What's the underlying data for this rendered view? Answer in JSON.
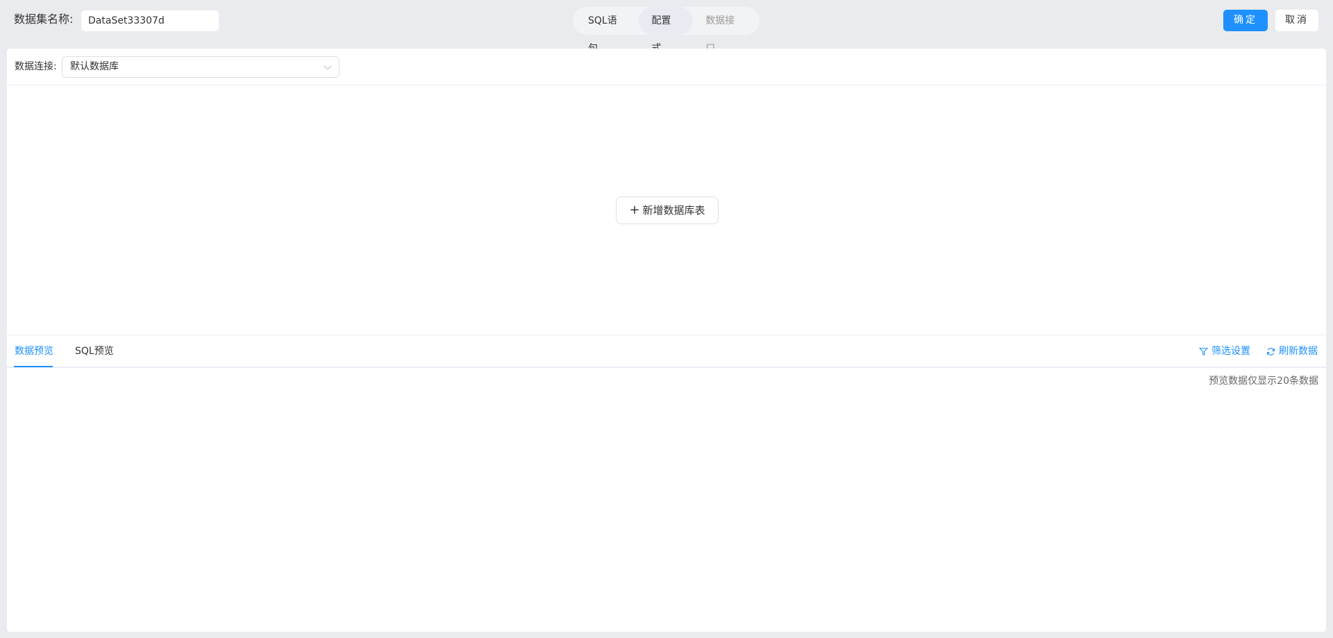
{
  "header": {
    "name_label": "数据集名称:",
    "name_value": "DataSet33307d",
    "modes": [
      {
        "label": "SQL语句",
        "state": "normal"
      },
      {
        "label": "配置式",
        "state": "active"
      },
      {
        "label": "数据接口",
        "state": "disabled"
      }
    ],
    "ok_label": "确定",
    "cancel_label": "取消"
  },
  "connection": {
    "label": "数据连接:",
    "selected": "默认数据库"
  },
  "canvas": {
    "add_table_label": "新增数据库表",
    "add_icon": "plus-icon"
  },
  "preview": {
    "tabs": [
      {
        "label": "数据预览",
        "active": true
      },
      {
        "label": "SQL预览",
        "active": false
      }
    ],
    "filter_label": "筛选设置",
    "refresh_label": "刷新数据",
    "note": "预览数据仅显示20条数据"
  },
  "colors": {
    "accent": "#1e90ff",
    "background": "#eaebef"
  }
}
